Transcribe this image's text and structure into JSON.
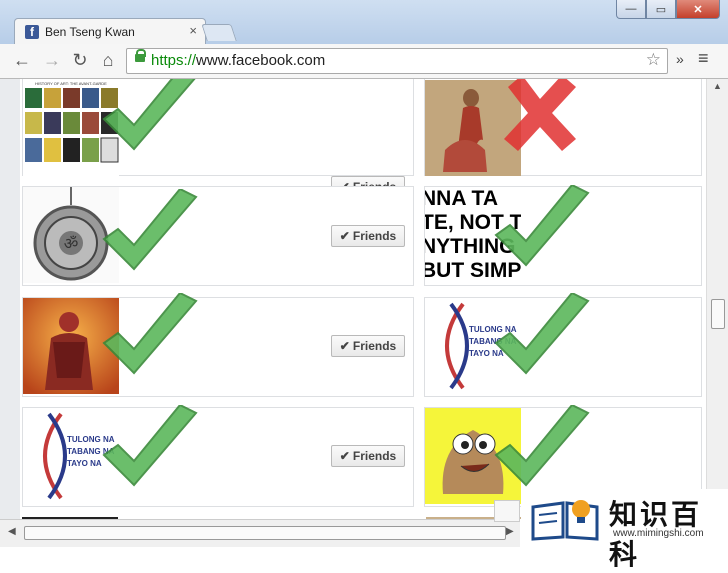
{
  "window": {
    "tab_title": "Ben Tseng Kwan",
    "tab_close": "×",
    "controls": {
      "minimize": "—",
      "maximize": "▭",
      "close": "✕"
    }
  },
  "toolbar": {
    "url_scheme": "https://",
    "url_host": "www.facebook.com",
    "back_glyph": "←",
    "forward_glyph": "→",
    "reload_glyph": "↻",
    "home_glyph": "⌂",
    "star_glyph": "☆",
    "more_glyph": "»",
    "menu_glyph": "≡"
  },
  "friends": {
    "button_label": "Friends",
    "check_glyph": "✔",
    "cards": [
      {
        "thumb": "history-of-art-collage",
        "status": "approved"
      },
      {
        "thumb": "woman-in-red-dress",
        "status": "rejected"
      },
      {
        "thumb": "silver-pendant",
        "status": "approved"
      },
      {
        "thumb": "text-poster",
        "status": "approved",
        "poster_lines": [
          "NNA TA",
          "TE, NOT T",
          "NYTHING",
          "BUT SIMP"
        ]
      },
      {
        "thumb": "anime-character",
        "status": "approved"
      },
      {
        "thumb": "tulong-na-tabang-logo",
        "status": "approved",
        "logo_lines": [
          "TULONG NA",
          "TABANG NA",
          "TAYO NA"
        ]
      },
      {
        "thumb": "tulong-na-tabang-logo",
        "status": "approved",
        "logo_lines": [
          "TULONG NA",
          "TABANG NA",
          "TAYO NA"
        ]
      },
      {
        "thumb": "pou-character",
        "status": "approved"
      }
    ],
    "collage_caption": "HISTORY OF ART: THE AVANT-GARDE"
  },
  "watermark": {
    "title": "知识百科",
    "url": "www.mimingshi.com"
  },
  "colors": {
    "approve_green": "#5cb85c",
    "reject_red": "#e03030",
    "facebook_blue": "#3b5998"
  }
}
